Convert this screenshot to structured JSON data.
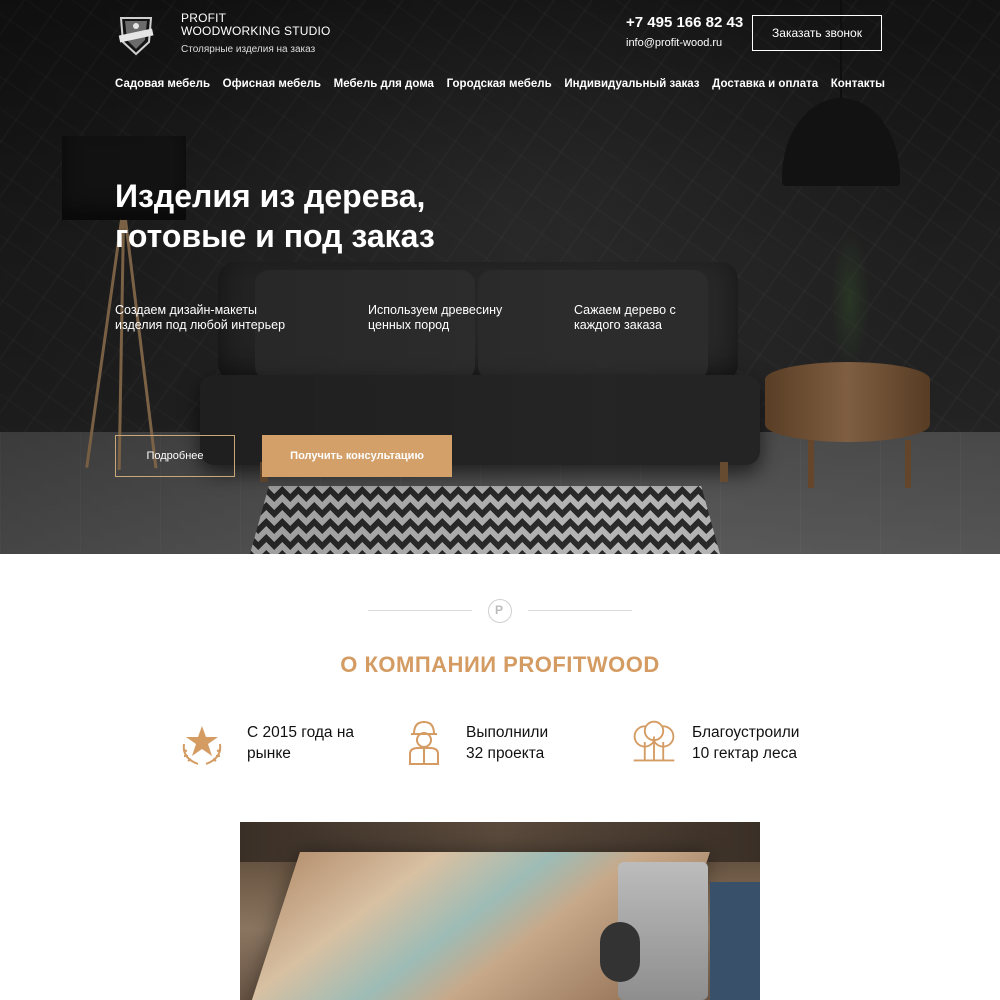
{
  "header": {
    "brand_line1": "PROFIT",
    "brand_line2": "WOODWORKING STUDIO",
    "tagline": "Столярные изделия на заказ",
    "phone": "+7 495 166 82 43",
    "email": "info@profit-wood.ru",
    "callback_label": "Заказать звонок"
  },
  "nav": {
    "items": [
      "Садовая мебель",
      "Офисная мебель",
      "Мебель для дома",
      "Городская мебель",
      "Индивидуальный заказ",
      "Доставка и оплата",
      "Контакты"
    ]
  },
  "hero": {
    "title_line1": "Изделия из дерева,",
    "title_line2": "готовые и под заказ",
    "features": [
      {
        "line1": "Создаем дизайн-макеты",
        "line2": "изделия под любой интерьер"
      },
      {
        "line1": "Используем древесину",
        "line2": "ценных пород"
      },
      {
        "line1": "Сажаем дерево с",
        "line2": "каждого заказа"
      }
    ],
    "more_label": "Подробнее",
    "consult_label": "Получить консультацию"
  },
  "about": {
    "title": "О КОМПАНИИ PROFITWOOD",
    "stats": [
      {
        "icon": "laurel-star-icon",
        "line1": "С 2015 года на",
        "line2": "рынке"
      },
      {
        "icon": "worker-icon",
        "line1": "Выполнили",
        "line2": "32 проекта"
      },
      {
        "icon": "forest-icon",
        "line1": "Благоустроили",
        "line2": "10 гектар леса"
      }
    ]
  },
  "colors": {
    "accent": "#d4a06a",
    "title_accent": "#d49b62",
    "hero_dark": "#222222"
  }
}
